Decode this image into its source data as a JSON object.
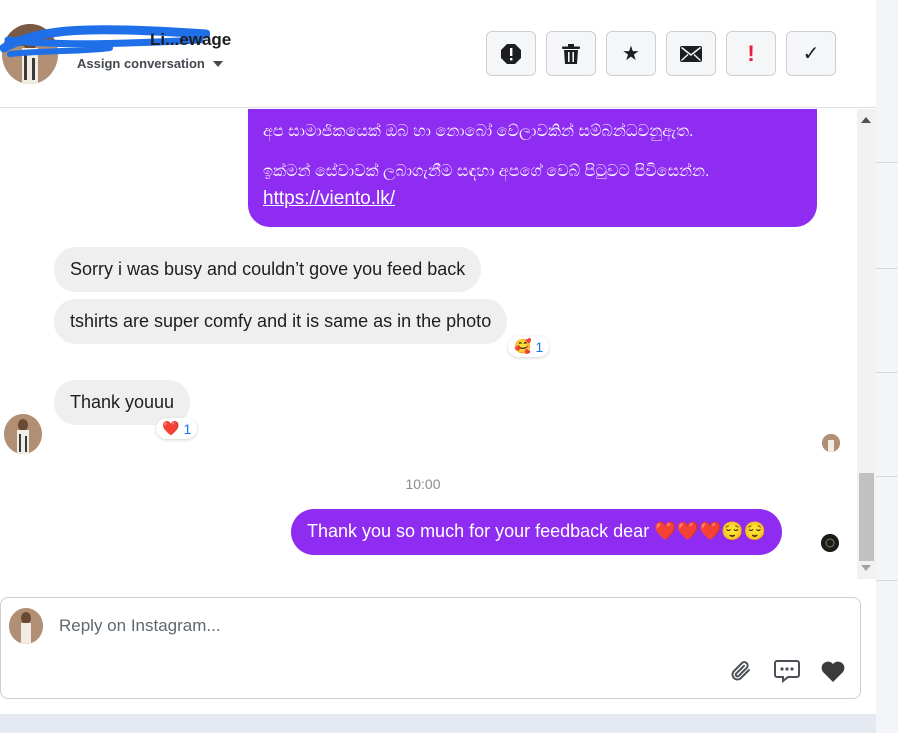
{
  "header": {
    "contact_name": "Li...ewage",
    "assign_label": "Assign conversation",
    "toolbar": [
      {
        "name": "report-button",
        "icon": "alert-octagon-icon",
        "glyph": "!"
      },
      {
        "name": "delete-button",
        "icon": "trash-icon"
      },
      {
        "name": "star-button",
        "icon": "star-icon",
        "glyph": "★"
      },
      {
        "name": "mark-unread-button",
        "icon": "envelope-icon"
      },
      {
        "name": "follow-up-button",
        "icon": "exclamation-icon",
        "glyph": "!"
      },
      {
        "name": "done-button",
        "icon": "check-icon",
        "glyph": "✓"
      }
    ]
  },
  "messages": {
    "outgoing_auto": {
      "line1": "අප සාමාජිකයෙක් ඔබ හා නොබෝ වේලාවකින්  සම්බන්ධවනුඇත.",
      "line2": "ඉක්මන් සේවාවක් ලබාගැනීම සඳහා අපගේ වෙබ් පිටුවට පිවිසෙන්න.",
      "link": "https://viento.lk/"
    },
    "incoming": [
      {
        "text": "Sorry i was busy and couldn’t gove you feed back"
      },
      {
        "text": "tshirts are super comfy and it is same as in the photo",
        "reaction": "🥰",
        "reaction_count": "1"
      },
      {
        "text": "Thank youuu",
        "reaction": "❤️",
        "reaction_count": "1"
      }
    ],
    "timestamp": "10:00",
    "outgoing_reply": "Thank you so much for your feedback dear ❤️❤️❤️😌😌"
  },
  "reply_box": {
    "placeholder": "Reply on Instagram..."
  },
  "colors": {
    "outgoing_bubble": "#8e2cf2",
    "incoming_bubble": "#efefef",
    "reaction_count": "#1877f2"
  }
}
